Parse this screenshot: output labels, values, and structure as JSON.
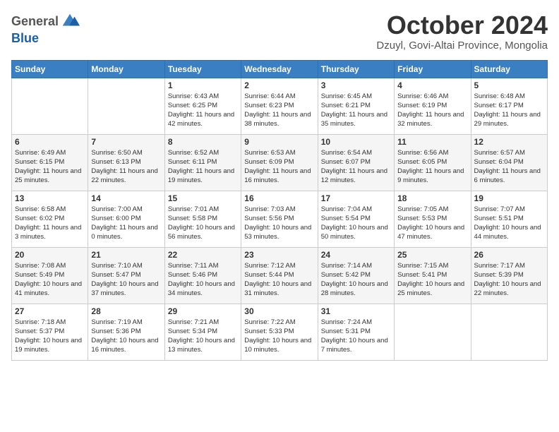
{
  "logo": {
    "general": "General",
    "blue": "Blue"
  },
  "title": {
    "month": "October 2024",
    "location": "Dzuyl, Govi-Altai Province, Mongolia"
  },
  "weekdays": [
    "Sunday",
    "Monday",
    "Tuesday",
    "Wednesday",
    "Thursday",
    "Friday",
    "Saturday"
  ],
  "weeks": [
    [
      {
        "day": "",
        "info": ""
      },
      {
        "day": "",
        "info": ""
      },
      {
        "day": "1",
        "info": "Sunrise: 6:43 AM\nSunset: 6:25 PM\nDaylight: 11 hours and 42 minutes."
      },
      {
        "day": "2",
        "info": "Sunrise: 6:44 AM\nSunset: 6:23 PM\nDaylight: 11 hours and 38 minutes."
      },
      {
        "day": "3",
        "info": "Sunrise: 6:45 AM\nSunset: 6:21 PM\nDaylight: 11 hours and 35 minutes."
      },
      {
        "day": "4",
        "info": "Sunrise: 6:46 AM\nSunset: 6:19 PM\nDaylight: 11 hours and 32 minutes."
      },
      {
        "day": "5",
        "info": "Sunrise: 6:48 AM\nSunset: 6:17 PM\nDaylight: 11 hours and 29 minutes."
      }
    ],
    [
      {
        "day": "6",
        "info": "Sunrise: 6:49 AM\nSunset: 6:15 PM\nDaylight: 11 hours and 25 minutes."
      },
      {
        "day": "7",
        "info": "Sunrise: 6:50 AM\nSunset: 6:13 PM\nDaylight: 11 hours and 22 minutes."
      },
      {
        "day": "8",
        "info": "Sunrise: 6:52 AM\nSunset: 6:11 PM\nDaylight: 11 hours and 19 minutes."
      },
      {
        "day": "9",
        "info": "Sunrise: 6:53 AM\nSunset: 6:09 PM\nDaylight: 11 hours and 16 minutes."
      },
      {
        "day": "10",
        "info": "Sunrise: 6:54 AM\nSunset: 6:07 PM\nDaylight: 11 hours and 12 minutes."
      },
      {
        "day": "11",
        "info": "Sunrise: 6:56 AM\nSunset: 6:05 PM\nDaylight: 11 hours and 9 minutes."
      },
      {
        "day": "12",
        "info": "Sunrise: 6:57 AM\nSunset: 6:04 PM\nDaylight: 11 hours and 6 minutes."
      }
    ],
    [
      {
        "day": "13",
        "info": "Sunrise: 6:58 AM\nSunset: 6:02 PM\nDaylight: 11 hours and 3 minutes."
      },
      {
        "day": "14",
        "info": "Sunrise: 7:00 AM\nSunset: 6:00 PM\nDaylight: 11 hours and 0 minutes."
      },
      {
        "day": "15",
        "info": "Sunrise: 7:01 AM\nSunset: 5:58 PM\nDaylight: 10 hours and 56 minutes."
      },
      {
        "day": "16",
        "info": "Sunrise: 7:03 AM\nSunset: 5:56 PM\nDaylight: 10 hours and 53 minutes."
      },
      {
        "day": "17",
        "info": "Sunrise: 7:04 AM\nSunset: 5:54 PM\nDaylight: 10 hours and 50 minutes."
      },
      {
        "day": "18",
        "info": "Sunrise: 7:05 AM\nSunset: 5:53 PM\nDaylight: 10 hours and 47 minutes."
      },
      {
        "day": "19",
        "info": "Sunrise: 7:07 AM\nSunset: 5:51 PM\nDaylight: 10 hours and 44 minutes."
      }
    ],
    [
      {
        "day": "20",
        "info": "Sunrise: 7:08 AM\nSunset: 5:49 PM\nDaylight: 10 hours and 41 minutes."
      },
      {
        "day": "21",
        "info": "Sunrise: 7:10 AM\nSunset: 5:47 PM\nDaylight: 10 hours and 37 minutes."
      },
      {
        "day": "22",
        "info": "Sunrise: 7:11 AM\nSunset: 5:46 PM\nDaylight: 10 hours and 34 minutes."
      },
      {
        "day": "23",
        "info": "Sunrise: 7:12 AM\nSunset: 5:44 PM\nDaylight: 10 hours and 31 minutes."
      },
      {
        "day": "24",
        "info": "Sunrise: 7:14 AM\nSunset: 5:42 PM\nDaylight: 10 hours and 28 minutes."
      },
      {
        "day": "25",
        "info": "Sunrise: 7:15 AM\nSunset: 5:41 PM\nDaylight: 10 hours and 25 minutes."
      },
      {
        "day": "26",
        "info": "Sunrise: 7:17 AM\nSunset: 5:39 PM\nDaylight: 10 hours and 22 minutes."
      }
    ],
    [
      {
        "day": "27",
        "info": "Sunrise: 7:18 AM\nSunset: 5:37 PM\nDaylight: 10 hours and 19 minutes."
      },
      {
        "day": "28",
        "info": "Sunrise: 7:19 AM\nSunset: 5:36 PM\nDaylight: 10 hours and 16 minutes."
      },
      {
        "day": "29",
        "info": "Sunrise: 7:21 AM\nSunset: 5:34 PM\nDaylight: 10 hours and 13 minutes."
      },
      {
        "day": "30",
        "info": "Sunrise: 7:22 AM\nSunset: 5:33 PM\nDaylight: 10 hours and 10 minutes."
      },
      {
        "day": "31",
        "info": "Sunrise: 7:24 AM\nSunset: 5:31 PM\nDaylight: 10 hours and 7 minutes."
      },
      {
        "day": "",
        "info": ""
      },
      {
        "day": "",
        "info": ""
      }
    ]
  ]
}
